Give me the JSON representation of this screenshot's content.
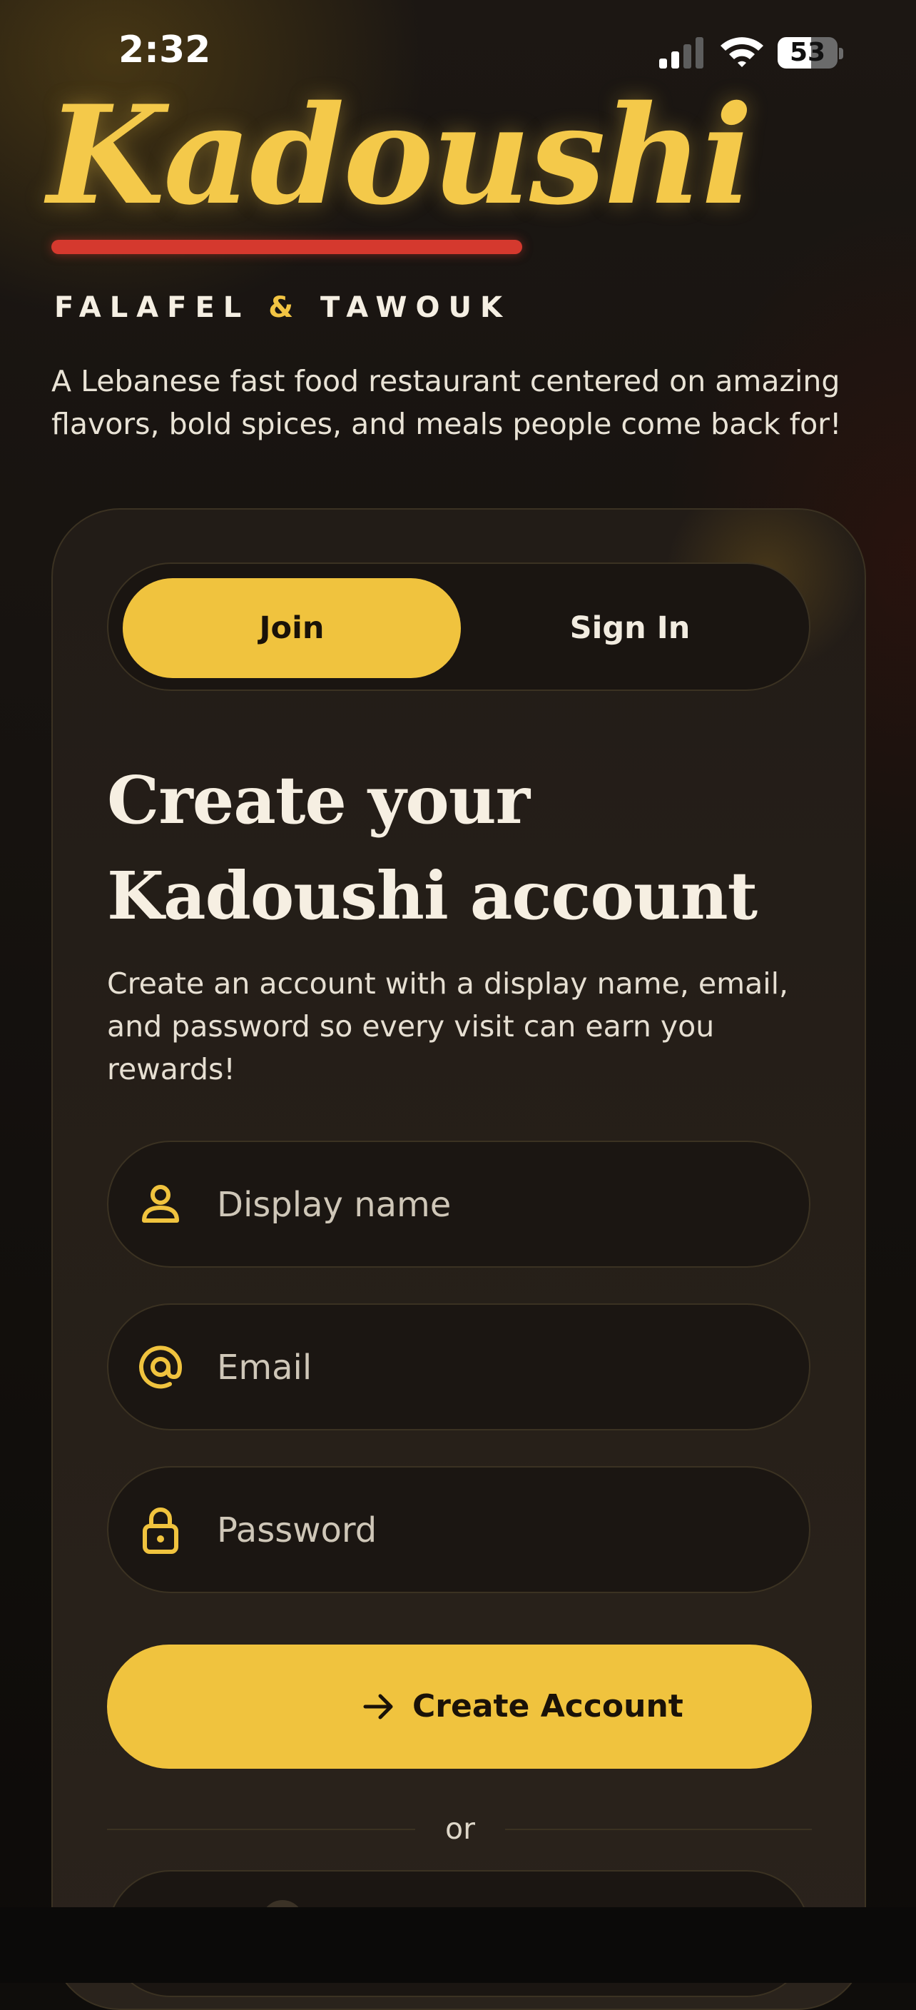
{
  "status_bar": {
    "time": "2:32",
    "battery": "53"
  },
  "brand": {
    "logo": "Kadoushi",
    "tagline_left": "FALAFEL",
    "tagline_amp": "&",
    "tagline_right": "TAWOUK",
    "intro": "A Lebanese fast food restaurant centered on amazing flavors, bold spices, and meals people come back for!"
  },
  "tabs": {
    "join": "Join",
    "sign_in": "Sign In",
    "active": "join"
  },
  "form": {
    "title": "Create your Kadoushi account",
    "description": "Create an account with a display name, email, and password so every visit can earn you rewards!",
    "display_name": {
      "placeholder": "Display name",
      "value": "",
      "icon": "user-icon"
    },
    "email": {
      "placeholder": "Email",
      "value": "",
      "icon": "at-icon"
    },
    "password": {
      "placeholder": "Password",
      "value": "",
      "icon": "lock-icon"
    },
    "submit_label": "Create Account",
    "submit_icon": "arrow-right-icon",
    "divider": "or"
  },
  "colors": {
    "accent": "#f0c33e",
    "logo": "#f4c94a",
    "underline": "#d5392e",
    "background": "#0f0d0b",
    "card": "#251f19"
  }
}
